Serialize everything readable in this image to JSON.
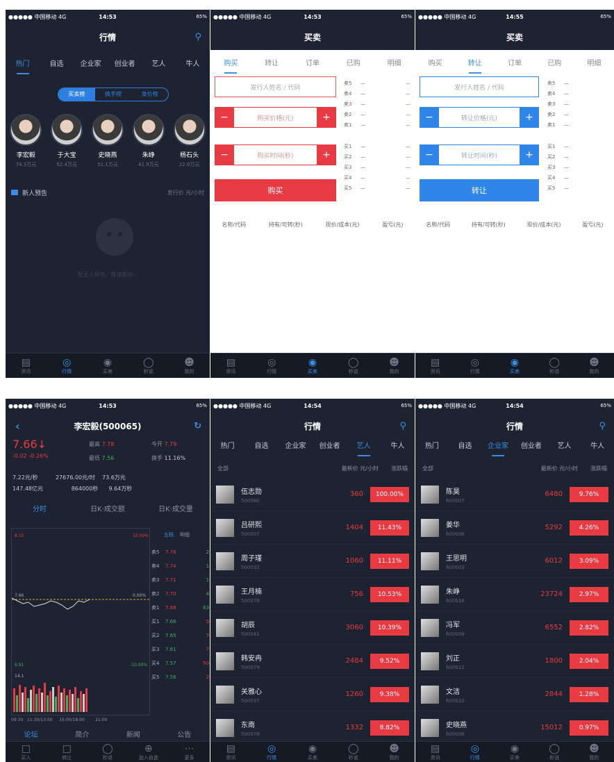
{
  "common": {
    "carrier": "●●●●● 中国移动 4G",
    "battery": "65%",
    "tabbar": [
      "资讯",
      "行情",
      "买卖",
      "秒说",
      "我的"
    ],
    "tabbar_detail": [
      "买入",
      "转让",
      "秒说",
      "加入自选",
      "更多"
    ]
  },
  "p1": {
    "time": "14:53",
    "title": "行情",
    "tabs": [
      "热门",
      "自选",
      "企业家",
      "创业者",
      "艺人",
      "牛人"
    ],
    "segments": [
      "买卖榜",
      "换手榜",
      "身价榜"
    ],
    "stars": [
      {
        "name": "李宏毅",
        "value": "74.3万元"
      },
      {
        "name": "于大宝",
        "value": "52.4万元"
      },
      {
        "name": "史晓燕",
        "value": "51.1万元"
      },
      {
        "name": "朱峥",
        "value": "41.9万元"
      },
      {
        "name": "杨石头",
        "value": "22.9万元"
      }
    ],
    "new_label": "新人预告",
    "new_right": "发行价 元/小时",
    "empty_text": "暂无人预告，敬请期待~"
  },
  "p2": {
    "time": "14:53",
    "title": "买卖",
    "tabs": [
      "购买",
      "转让",
      "订单",
      "已购",
      "明细"
    ],
    "name_ph": "发行人姓名 / 代码",
    "price_ph": "购买价格(元)",
    "time_ph": "购买时间(秒)",
    "button": "购买",
    "asks": [
      "卖5",
      "卖4",
      "卖3",
      "卖2",
      "卖1"
    ],
    "bids": [
      "买1",
      "买2",
      "买3",
      "买4",
      "买5"
    ],
    "dash": "—",
    "cols": [
      "名称/代码",
      "持有/可转(秒)",
      "现价/成本(元)",
      "盈亏(元)"
    ]
  },
  "p3": {
    "time": "14:55",
    "title": "买卖",
    "tabs": [
      "购买",
      "转让",
      "订单",
      "已购",
      "明细"
    ],
    "name_ph": "发行人姓名 / 代码",
    "price_ph": "转让价格(元)",
    "time_ph": "转让时间(秒)",
    "button": "转让",
    "cols": [
      "名称/代码",
      "持有/可转(秒)",
      "现价/成本(元)",
      "盈亏(元)"
    ]
  },
  "p4": {
    "time": "14:53",
    "title": "李宏毅(500065)",
    "price": "7.66",
    "change": "-0.02  -0.26%",
    "high_label": "最高",
    "high": "7.78",
    "open_label": "今开",
    "open": "7.79",
    "low_label": "最低",
    "low": "7.56",
    "turn_label": "换手",
    "turn": "11.16%",
    "r1": [
      "7.22元/秒",
      "27676.00元/时",
      "73.6万元"
    ],
    "r2": [
      "147.48亿元",
      "864000秒",
      "9.64万秒"
    ],
    "subtabs": [
      "分时",
      "日K·成交额",
      "日K·成交量"
    ],
    "chart_labels": {
      "top_l": "8.15",
      "top_r": "10.00%",
      "mid_l": "7.66",
      "mid_r": "0.00%",
      "bot_l": "6.91",
      "bot_r": "-10.00%",
      "vol": "14.1"
    },
    "axis": [
      "09:30",
      "11:30/13:00",
      "15:00/18:00",
      "21:00"
    ],
    "ob_head": [
      "五档",
      "明细"
    ],
    "ob": [
      [
        "卖5",
        "7.78",
        "250"
      ],
      [
        "卖4",
        "7.74",
        "120"
      ],
      [
        "卖3",
        "7.71",
        "100"
      ],
      [
        "卖2",
        "7.70",
        "440"
      ],
      [
        "卖1",
        "7.68",
        "6300"
      ],
      [
        "买1",
        "7.66",
        "500"
      ],
      [
        "买2",
        "7.65",
        "700"
      ],
      [
        "买3",
        "7.61",
        "720"
      ],
      [
        "买4",
        "7.57",
        "5000"
      ],
      [
        "买5",
        "7.56",
        "280"
      ]
    ],
    "bottom_tabs": [
      "论坛",
      "简介",
      "新闻",
      "公告"
    ]
  },
  "p5": {
    "time": "14:54",
    "title": "行情",
    "tabs": [
      "热门",
      "自选",
      "企业家",
      "创业者",
      "艺人",
      "牛人"
    ],
    "filter_all": "全部",
    "filter_price": "最新价 元/小时",
    "filter_pct": "涨跌幅",
    "rows": [
      {
        "name": "伍志勋",
        "code": "500080",
        "price": "360",
        "pct": "100.00%"
      },
      {
        "name": "吕研熙",
        "code": "500007",
        "price": "1404",
        "pct": "11.43%"
      },
      {
        "name": "周子瑾",
        "code": "500032",
        "price": "1060",
        "pct": "11.11%"
      },
      {
        "name": "王月楠",
        "code": "500078",
        "price": "756",
        "pct": "10.53%"
      },
      {
        "name": "胡辰",
        "code": "500041",
        "price": "3060",
        "pct": "10.39%"
      },
      {
        "name": "韩安冉",
        "code": "500079",
        "price": "2484",
        "pct": "9.52%"
      },
      {
        "name": "关雅心",
        "code": "500037",
        "price": "1260",
        "pct": "9.38%"
      },
      {
        "name": "东南",
        "code": "500078",
        "price": "1332",
        "pct": "8.82%"
      }
    ]
  },
  "p6": {
    "time": "14:54",
    "title": "行情",
    "tabs": [
      "热门",
      "自选",
      "企业家",
      "创业者",
      "艺人",
      "牛人"
    ],
    "filter_all": "全部",
    "filter_price": "最新价 元/小时",
    "filter_pct": "涨跌幅",
    "rows": [
      {
        "name": "陈昊",
        "code": "600007",
        "price": "6480",
        "pct": "9.76%"
      },
      {
        "name": "姜华",
        "code": "600006",
        "price": "5292",
        "pct": "4.26%"
      },
      {
        "name": "王思明",
        "code": "600003",
        "price": "6012",
        "pct": "3.09%"
      },
      {
        "name": "朱峥",
        "code": "600016",
        "price": "23724",
        "pct": "2.97%"
      },
      {
        "name": "冯军",
        "code": "600008",
        "price": "6552",
        "pct": "2.82%"
      },
      {
        "name": "刘正",
        "code": "600012",
        "price": "1800",
        "pct": "2.04%"
      },
      {
        "name": "文洁",
        "code": "600010",
        "price": "2844",
        "pct": "1.28%"
      },
      {
        "name": "史晓燕",
        "code": "600006",
        "price": "15012",
        "pct": "0.97%"
      }
    ]
  }
}
